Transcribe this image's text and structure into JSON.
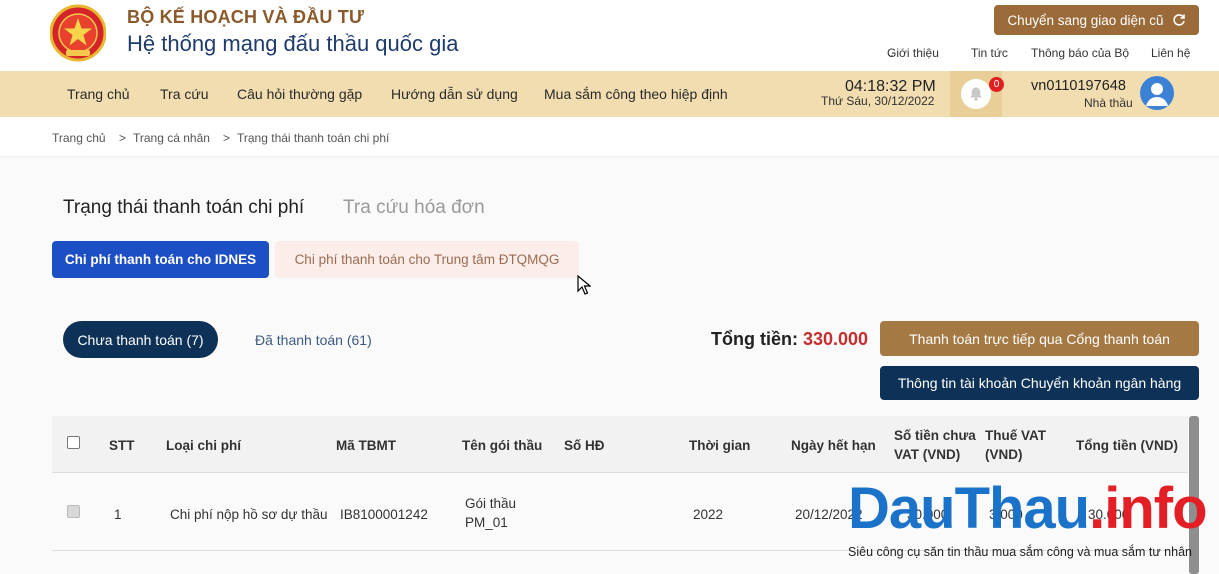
{
  "header": {
    "ministry": "BỘ KẾ HOẠCH VÀ ĐẦU TƯ",
    "system_name": "Hệ thống mạng đấu thầu quốc gia",
    "switch_label": "Chuyển sang giao diện cũ",
    "top_links": [
      "Giới thiệu",
      "Tin tức",
      "Thông báo của Bộ",
      "Liên hệ"
    ]
  },
  "nav": {
    "items": [
      "Trang chủ",
      "Tra cứu",
      "Câu hỏi thường gặp",
      "Hướng dẫn sử dụng",
      "Mua sắm công theo hiệp định"
    ],
    "time": "04:18:32 PM",
    "date": "Thứ Sáu, 30/12/2022",
    "notification_count": "0",
    "user_id": "vn0110197648",
    "user_role": "Nhà thầu"
  },
  "breadcrumb": [
    "Trang chủ",
    "Trang cá nhân",
    "Trạng thái thanh toán chi phí"
  ],
  "page": {
    "tab_active": "Trạng thái thanh toán chi phí",
    "tab_inactive": "Tra cứu hóa đơn",
    "category_active": "Chi phí thanh toán cho IDNES",
    "category_inactive": "Chi phí thanh toán cho Trung tâm ĐTQMQG",
    "status_unpaid": "Chưa thanh toán (7)",
    "status_paid": "Đã thanh toán (61)",
    "total_label": "Tổng tiền:",
    "total_value": "330.000",
    "pay_button": "Thanh toán trực tiếp qua Cổng thanh toán",
    "bank_button": "Thông tin tài khoản Chuyển khoản ngân hàng"
  },
  "table": {
    "headers": {
      "stt": "STT",
      "type": "Loại chi phí",
      "code": "Mã TBMT",
      "package": "Tên gói thầu",
      "contract": "Số HĐ",
      "time": "Thời gian",
      "expiry": "Ngày hết hạn",
      "pre_vat_1": "Số tiền chưa",
      "pre_vat_2": "VAT (VND)",
      "vat_1": "Thuế VAT",
      "vat_2": "(VND)",
      "total": "Tổng tiền (VND)"
    },
    "rows": [
      {
        "stt": "1",
        "type": "Chi phí nộp hồ sơ dự thầu",
        "code": "IB8100001242",
        "package_1": "Gói thầu",
        "package_2": "PM_01",
        "contract": "",
        "time": "2022",
        "expiry": "20/12/2022",
        "pre_vat": "30.000",
        "vat": "3.000",
        "total": "30.000"
      }
    ]
  },
  "watermark": {
    "brand_part1": "DauThau",
    "brand_part2": ".info",
    "tagline": "Siêu công cụ săn tin thầu mua sắm công và mua sắm tư nhân"
  },
  "colors": {
    "nav_bg": "#f1ddb0",
    "primary_blue": "#1d4fc4",
    "navy": "#0e3257",
    "brown": "#a57943",
    "total_red": "#c62e2e",
    "watermark_blue": "#1a73c9",
    "watermark_red": "#e31e24"
  }
}
